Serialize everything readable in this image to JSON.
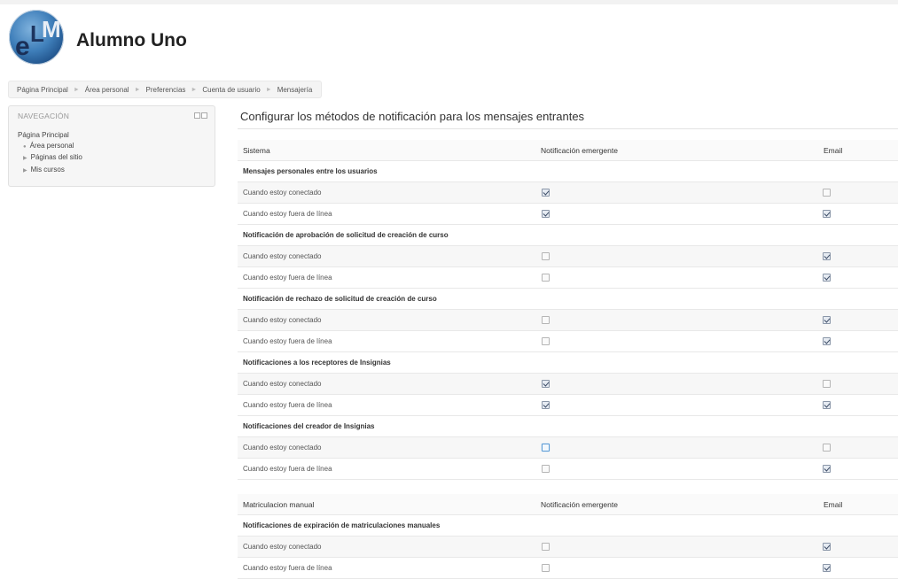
{
  "header": {
    "site_title": "Alumno Uno",
    "logo_text": "eLM"
  },
  "breadcrumb": [
    "Página Principal",
    "Área personal",
    "Preferencias",
    "Cuenta de usuario",
    "Mensajería"
  ],
  "navigation": {
    "title": "NAVEGACIÓN",
    "home": "Página Principal",
    "items": [
      "Área personal",
      "Páginas del sitio",
      "Mis cursos"
    ]
  },
  "main": {
    "title": "Configurar los métodos de notificación para los mensajes entrantes",
    "tables": [
      {
        "headers": [
          "Sistema",
          "Notificación emergente",
          "Email"
        ],
        "sections": [
          {
            "title": "Mensajes personales entre los usuarios",
            "rows": [
              {
                "label": "Cuando estoy conectado",
                "popup": true,
                "email": false
              },
              {
                "label": "Cuando estoy fuera de línea",
                "popup": true,
                "email": true
              }
            ]
          },
          {
            "title": "Notificación de aprobación de solicitud de creación de curso",
            "rows": [
              {
                "label": "Cuando estoy conectado",
                "popup": false,
                "email": true
              },
              {
                "label": "Cuando estoy fuera de línea",
                "popup": false,
                "email": true
              }
            ]
          },
          {
            "title": "Notificación de rechazo de solicitud de creación de curso",
            "rows": [
              {
                "label": "Cuando estoy conectado",
                "popup": false,
                "email": true
              },
              {
                "label": "Cuando estoy fuera de línea",
                "popup": false,
                "email": true
              }
            ]
          },
          {
            "title": "Notificaciones a los receptores de Insignias",
            "rows": [
              {
                "label": "Cuando estoy conectado",
                "popup": true,
                "email": false
              },
              {
                "label": "Cuando estoy fuera de línea",
                "popup": true,
                "email": true
              }
            ]
          },
          {
            "title": "Notificaciones del creador de Insignias",
            "rows": [
              {
                "label": "Cuando estoy conectado",
                "popup": false,
                "email": false
              },
              {
                "label": "Cuando estoy fuera de línea",
                "popup": false,
                "email": true
              }
            ]
          }
        ]
      },
      {
        "headers": [
          "Matriculacion manual",
          "Notificación emergente",
          "Email"
        ],
        "sections": [
          {
            "title": "Notificaciones de expiración de matriculaciones manuales",
            "rows": [
              {
                "label": "Cuando estoy conectado",
                "popup": false,
                "email": true
              },
              {
                "label": "Cuando estoy fuera de línea",
                "popup": false,
                "email": true
              }
            ]
          }
        ]
      }
    ]
  }
}
